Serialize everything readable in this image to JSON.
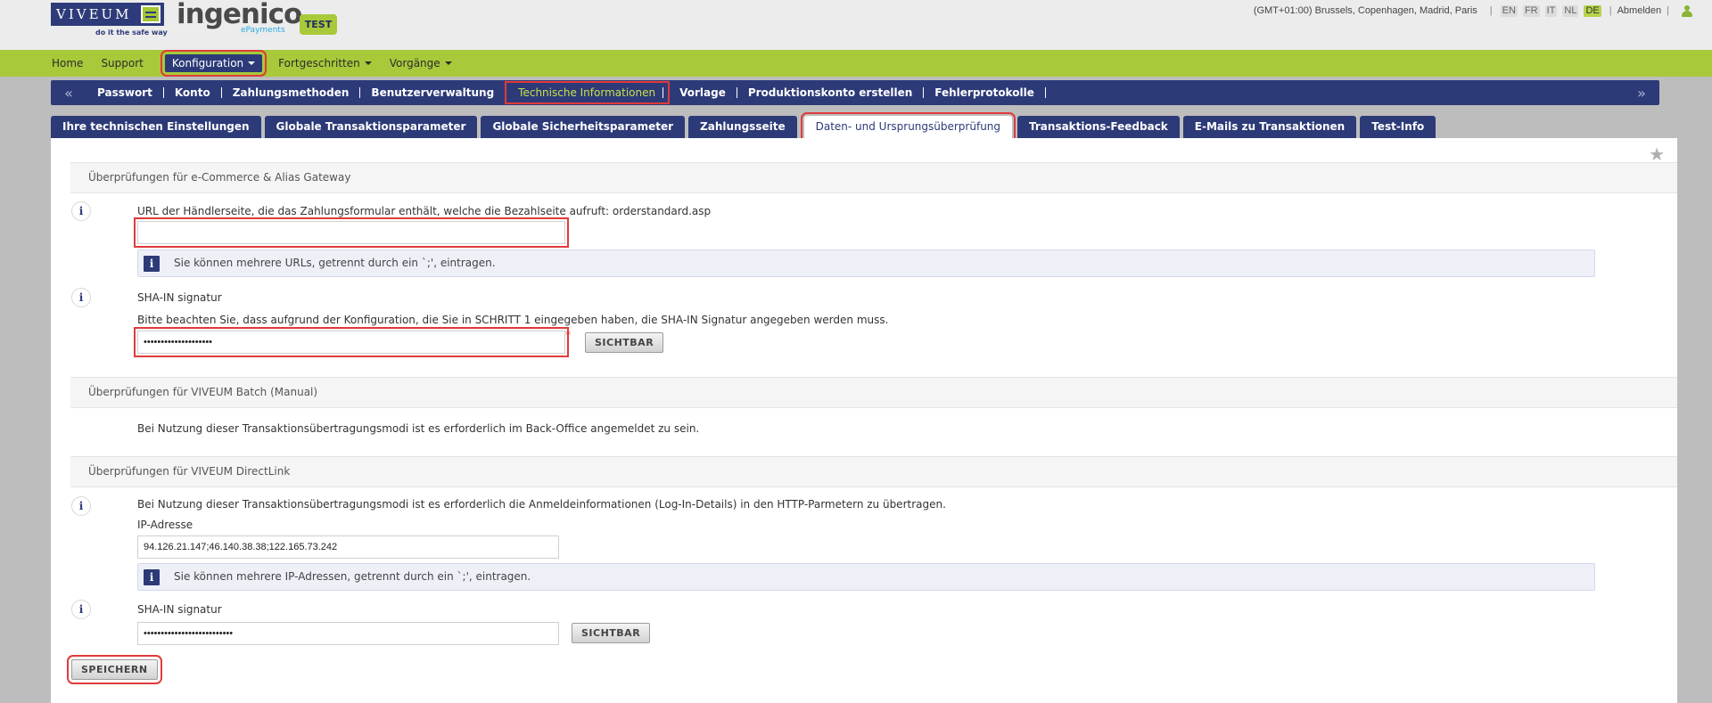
{
  "header": {
    "viveum_logo": "VIVEUM",
    "viveum_tagline": "do it the safe way",
    "ingenico_logo": "ingenico",
    "ingenico_sub": "ePayments",
    "env_badge": "TEST",
    "timezone": "(GMT+01:00) Brussels, Copenhagen, Madrid, Paris",
    "languages": [
      "EN",
      "FR",
      "IT",
      "NL",
      "DE"
    ],
    "active_language": "DE",
    "logout": "Abmelden"
  },
  "mainnav": {
    "items": [
      "Home",
      "Support",
      "Konfiguration",
      "Fortgeschritten",
      "Vorgänge"
    ],
    "active": "Konfiguration"
  },
  "subnav": {
    "items": [
      "Passwort",
      "Konto",
      "Zahlungsmethoden",
      "Benutzerverwaltung",
      "Technische Informationen",
      "Vorlage",
      "Produktionskonto erstellen",
      "Fehlerprotokolle"
    ],
    "active": "Technische Informationen"
  },
  "tabs": {
    "items": [
      "Ihre technischen Einstellungen",
      "Globale Transaktionsparameter",
      "Globale Sicherheitsparameter",
      "Zahlungsseite",
      "Daten- und Ursprungsüberprüfung",
      "Transaktions-Feedback",
      "E-Mails zu Transaktionen",
      "Test-Info"
    ],
    "active": "Daten- und Ursprungsüberprüfung"
  },
  "ecommerce": {
    "heading": "Überprüfungen für e-Commerce & Alias Gateway",
    "url_label": "URL der Händlerseite, die das Zahlungsformular enthält, welche die Bezahlseite aufruft: orderstandard.asp",
    "url_value": "",
    "url_hint": "Sie können mehrere URLs, getrennt durch ein `;', eintragen.",
    "sha_label": "SHA-IN signatur",
    "sha_note": "Bitte beachten Sie, dass aufgrund der Konfiguration, die Sie in SCHRITT 1 eingegeben haben, die SHA-IN Signatur angegeben werden muss.",
    "sha_value": "••••••••••••••••••••",
    "required_mark": "*",
    "show_button": "SICHTBAR"
  },
  "batch": {
    "heading": "Überprüfungen für VIVEUM Batch (Manual)",
    "note": "Bei Nutzung dieser Transaktionsübertragungsmodi ist es erforderlich im Back-Office angemeldet zu sein."
  },
  "directlink": {
    "heading": "Überprüfungen für VIVEUM DirectLink",
    "note": "Bei Nutzung dieser Transaktionsübertragungsmodi ist es erforderlich die Anmeldeinformationen (Log-In-Details) in den HTTP-Parmetern zu übertragen.",
    "ip_label": "IP-Adresse",
    "ip_value": "94.126.21.147;46.140.38.38;122.165.73.242",
    "ip_hint": "Sie können mehrere IP-Adressen, getrennt durch ein `;', eintragen.",
    "sha_label": "SHA-IN signatur",
    "sha_value": "••••••••••••••••••••••••••",
    "show_button": "SICHTBAR"
  },
  "save_button": "SPEICHERN",
  "colors": {
    "brand_blue": "#2d3a78",
    "brand_green": "#a8c93a",
    "highlight_red": "#e03a3a"
  }
}
